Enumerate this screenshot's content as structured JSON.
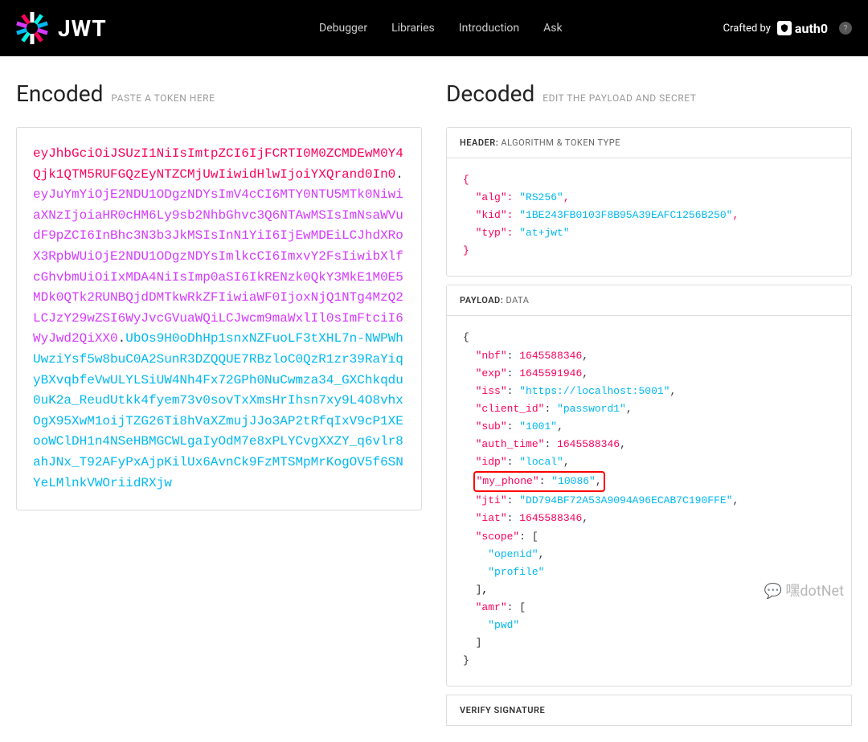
{
  "nav": {
    "links": [
      "Debugger",
      "Libraries",
      "Introduction",
      "Ask"
    ],
    "crafted_by": "Crafted by",
    "brand": "auth0"
  },
  "encoded": {
    "title": "Encoded",
    "hint": "PASTE A TOKEN HERE",
    "header": "eyJhbGciOiJSUzI1NiIsImtpZCI6IjFCRTI0M0ZCMDEwM0Y4Qjk1QTM5RUFGQzEyNTZCMjUwIiwidHlwIjoiYXQrand0In0",
    "payload": "eyJuYmYiOjE2NDU1ODgzNDYsImV4cCI6MTY0NTU5MTk0NiwiaXNzIjoiaHR0cHM6Ly9sb2NhbGhvc3Q6NTAwMSIsImNsaWVudF9pZCI6InBhc3N3b3JkMSIsInN1YiI6IjEwMDEiLCJhdXRoX3RpbWUiOjE2NDU1ODgzNDYsImlkcCI6ImxvY2FsIiwibXlfcGhvbmUiOiIxMDA4NiIsImp0aSI6IkRENzk0QkY3MkE1M0E5MDk0QTk2RUNBQjdDMTkwRkZFIiwiaWF0IjoxNjQ1NTg4MzQ2LCJzY29wZSI6WyJvcGVuaWQiLCJwcm9maWxlIl0sImFtciI6WyJwd2QiXX0",
    "signature": "UbOs9H0oDhHp1snxNZFuoLF3tXHL7n-NWPWhUwziYsf5w8buC0A2SunR3DZQQUE7RBzloC0QzR1zr39RaYiqyBXvqbfeVwULYLSiUW4Nh4Fx72GPh0NuCwmza34_GXChkqdu0uK2a_ReudUtkk4fyem73v0sovTxXmsHrIhsn7xy9L4O8vhxOgX95XwM1oijTZG26Ti8hVaXZmujJJo3AP2tRfqIxV9cP1XEooWClDH1n4NSeHBMGCWLgaIyOdM7e8xPLYCvgXXZY_q6vlr8ahJNx_T92AFyPxAjpKilUx6AvnCk9FzMTSMpMrKogOV5f6SNYeLMlnkVWOriidRXjw"
  },
  "decoded": {
    "title": "Decoded",
    "hint": "EDIT THE PAYLOAD AND SECRET",
    "header_label": "HEADER:",
    "header_sub": "ALGORITHM & TOKEN TYPE",
    "payload_label": "PAYLOAD:",
    "payload_sub": "DATA",
    "verify_label": "VERIFY SIGNATURE",
    "header_data": {
      "alg": "RS256",
      "kid": "1BE243FB0103F8B95A39EAFC1256B250",
      "typ": "at+jwt"
    },
    "payload_data": {
      "nbf": 1645588346,
      "exp": 1645591946,
      "iss": "https://localhost:5001",
      "client_id": "password1",
      "sub": "1001",
      "auth_time": 1645588346,
      "idp": "local",
      "my_phone": "10086",
      "jti": "DD794BF72A53A9094A96ECAB7C190FFE",
      "iat": 1645588346,
      "scope": [
        "openid",
        "profile"
      ],
      "amr": [
        "pwd"
      ]
    },
    "highlighted_key": "my_phone"
  },
  "watermark": "嘿dotNet"
}
